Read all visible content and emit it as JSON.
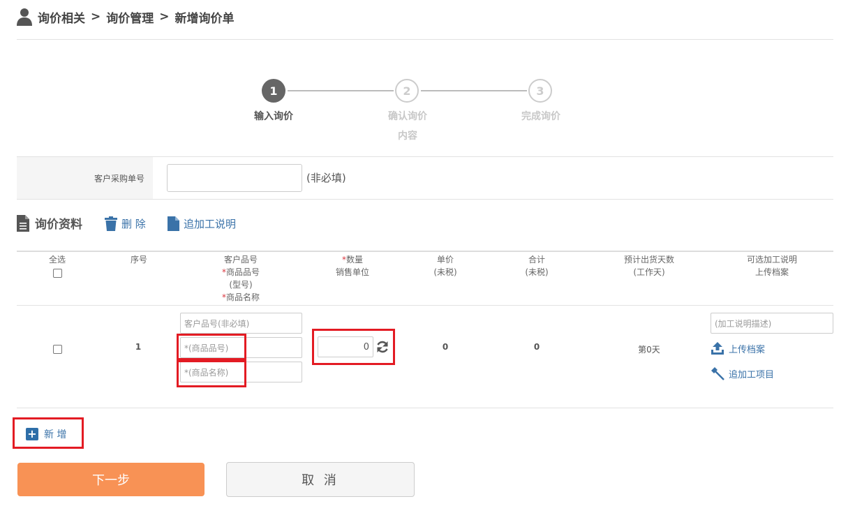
{
  "breadcrumb": [
    "询价相关",
    "询价管理",
    "新增询价单"
  ],
  "breadcrumb_sep": ">",
  "steps": [
    {
      "num": "1",
      "label": "输入询价",
      "label2": ""
    },
    {
      "num": "2",
      "label": "确认询价",
      "label2": "内容"
    },
    {
      "num": "3",
      "label": "完成询价",
      "label2": ""
    }
  ],
  "po": {
    "label": "客户采购单号",
    "value": "",
    "note": "(非必填)"
  },
  "section": {
    "title": "询价资料",
    "delete_label": "删 除",
    "addwork_label": "追加工说明"
  },
  "table": {
    "headers": {
      "select_all": "全选",
      "seq": "序号",
      "col3_line1": "客户品号",
      "col3_line2": "商品品号",
      "col3_line3": "(型号)",
      "col3_line4": "商品名称",
      "col4_line1": "数量",
      "col4_line2": "销售单位",
      "col5_line1": "单价",
      "col5_line2": "(未税)",
      "col6_line1": "合计",
      "col6_line2": "(未税)",
      "col7_line1": "预计出货天数",
      "col7_line2": "(工作天)",
      "col8_line1": "可选加工说明",
      "col8_line2": "上传档案"
    },
    "required_mark": "*",
    "row": {
      "seq": "1",
      "customer_part_placeholder": "客户品号(非必填)",
      "product_no_placeholder": "*(商品品号)",
      "product_name_placeholder": "*(商品名称)",
      "quantity": "0",
      "unit_price": "0",
      "total": "0",
      "days": "第0天",
      "work_desc_placeholder": "(加工说明描述)",
      "upload_label": "上传档案",
      "add_item_label": "追加工项目"
    }
  },
  "add_label": "新 增",
  "next_label": "下一步",
  "cancel_label": "取 消"
}
